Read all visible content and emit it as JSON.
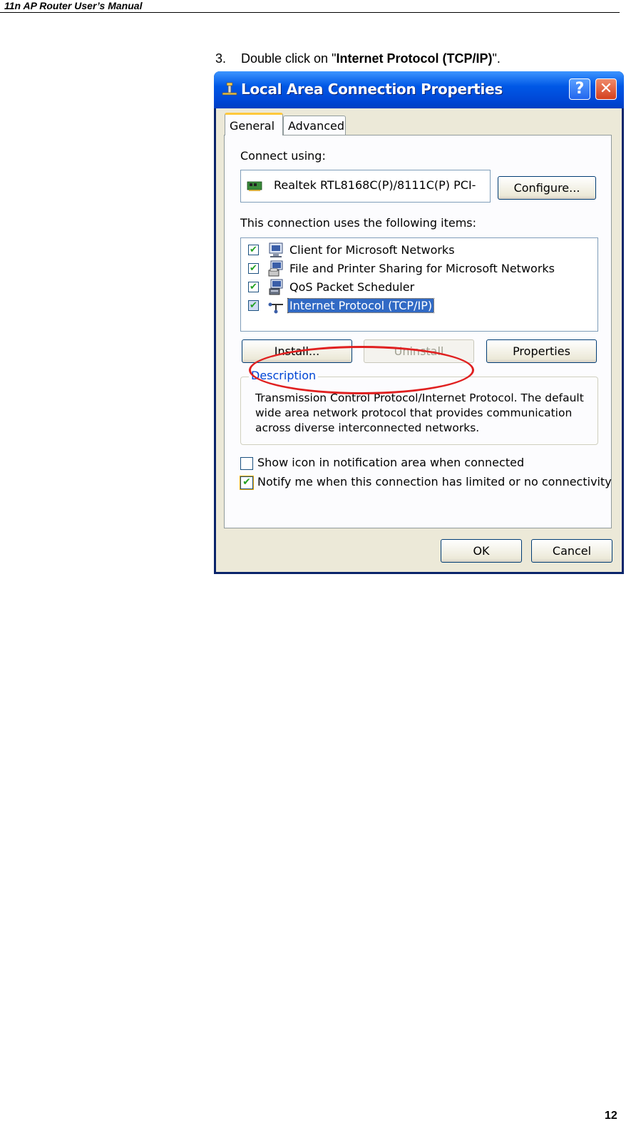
{
  "page": {
    "header": "11n AP Router User’s Manual",
    "step_number": "3.",
    "step_text_pre": "Double click on \"",
    "step_text_bold": "Internet Protocol (TCP/IP)",
    "step_text_post": "\".",
    "page_number": "12"
  },
  "dialog": {
    "title": "Local Area Connection Properties",
    "help_glyph": "?",
    "close_glyph": "✕",
    "tabs": [
      {
        "label": "General",
        "active": true
      },
      {
        "label": "Advanced",
        "active": false
      }
    ],
    "connect_using_label": "Connect using:",
    "adapter_name": "Realtek RTL8168C(P)/8111C(P) PCI-",
    "configure_button": "Configure...",
    "items_label": "This connection uses the following items:",
    "items": [
      {
        "label": "Client for Microsoft Networks",
        "checked": true,
        "icon": "client-network-icon"
      },
      {
        "label": "File and Printer Sharing for Microsoft Networks",
        "checked": true,
        "icon": "file-printer-sharing-icon"
      },
      {
        "label": "QoS Packet Scheduler",
        "checked": true,
        "icon": "qos-scheduler-icon"
      },
      {
        "label": "Internet Protocol (TCP/IP)",
        "checked": true,
        "icon": "protocol-icon",
        "selected": true
      }
    ],
    "check_glyph": "✔",
    "install_button": "Install...",
    "uninstall_button": "Uninstall",
    "properties_button": "Properties",
    "description_legend": "Description",
    "description_lines": [
      "Transmission Control Protocol/Internet Protocol. The default",
      "wide area network protocol that provides communication",
      "across diverse interconnected networks."
    ],
    "options": [
      {
        "label": "Show icon in notification area when connected",
        "checked": false
      },
      {
        "label": "Notify me when this connection has limited or no connectivity",
        "checked": true
      }
    ],
    "ok_button": "OK",
    "cancel_button": "Cancel"
  },
  "colors": {
    "titlebar_blue": "#0058e6",
    "selection_blue": "#316ac5",
    "highlight_red": "#e02020",
    "dialog_face": "#ece9d8"
  }
}
